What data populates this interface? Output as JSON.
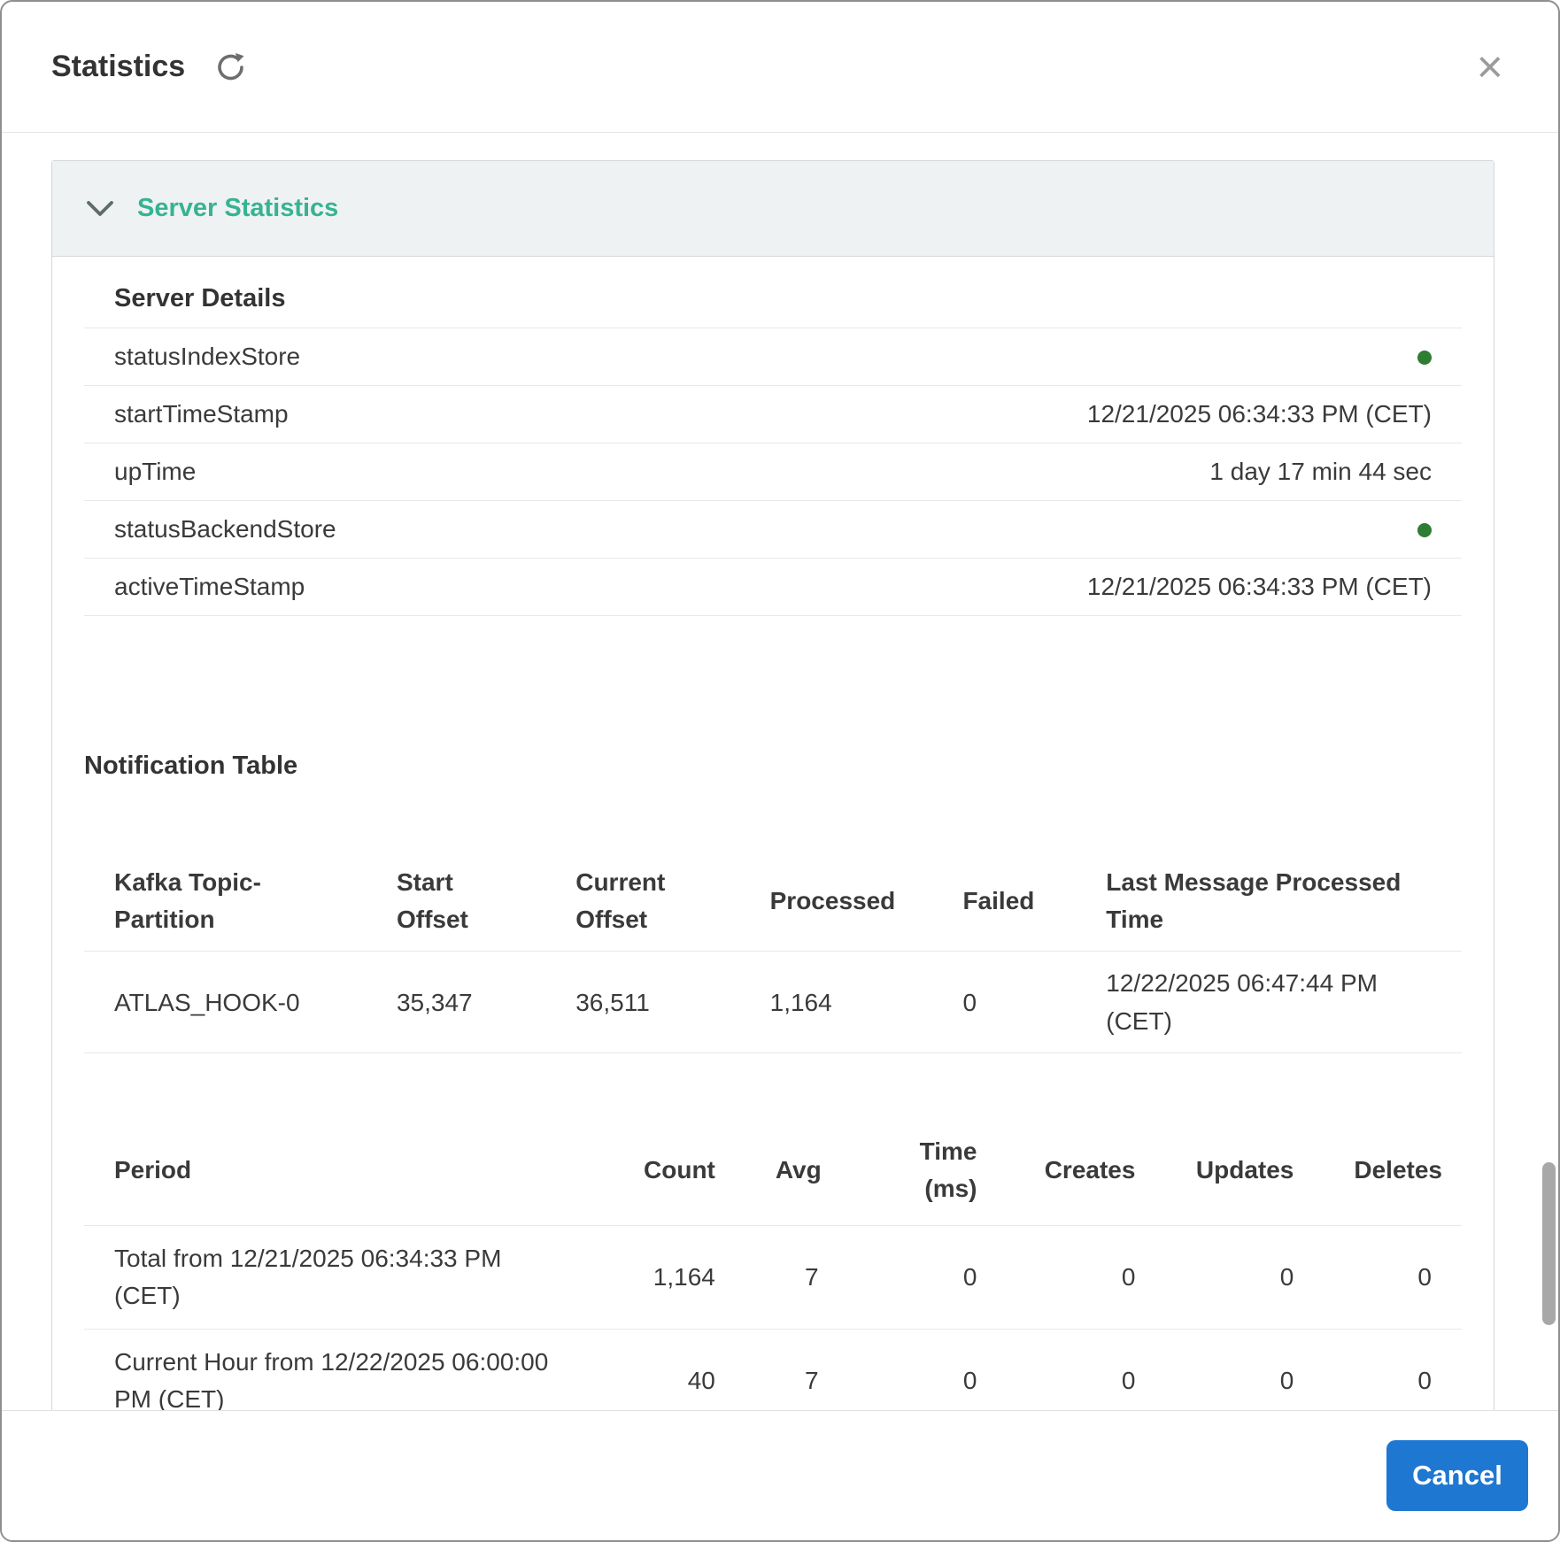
{
  "colors": {
    "accent_teal": "#36b392",
    "status_green": "#2e7d32",
    "primary_blue": "#1e78d2"
  },
  "header": {
    "title": "Statistics"
  },
  "icons": {
    "refresh_glyph": "⟳",
    "close_glyph": "×",
    "chevron_glyph": "⌄",
    "status_dot_glyph": "●"
  },
  "accordion": {
    "title": "Server Statistics"
  },
  "server_details": {
    "heading": "Server Details",
    "rows": [
      {
        "key": "statusIndexStore",
        "value": "",
        "status": "green"
      },
      {
        "key": "startTimeStamp",
        "value": "12/21/2025 06:34:33 PM (CET)"
      },
      {
        "key": "upTime",
        "value": "1 day 17 min 44 sec"
      },
      {
        "key": "statusBackendStore",
        "value": "",
        "status": "green"
      },
      {
        "key": "activeTimeStamp",
        "value": "12/21/2025 06:34:33 PM (CET)"
      }
    ]
  },
  "notification": {
    "heading": "Notification Table",
    "kafka_table": {
      "headers": [
        "Kafka Topic-Partition",
        "Start Offset",
        "Current Offset",
        "Processed",
        "Failed",
        "Last Message Processed Time"
      ],
      "rows": [
        [
          "ATLAS_HOOK-0",
          "35,347",
          "36,511",
          "1,164",
          "0",
          "12/22/2025 06:47:44 PM (CET)"
        ]
      ]
    },
    "period_table": {
      "headers": [
        "Period",
        "Count",
        "Avg",
        "Time (ms)",
        "Creates",
        "Updates",
        "Deletes"
      ],
      "rows": [
        [
          "Total from 12/21/2025 06:34:33 PM (CET)",
          "1,164",
          "7",
          "0",
          "0",
          "0",
          "0"
        ],
        [
          "Current Hour from 12/22/2025 06:00:00 PM (CET)",
          "40",
          "7",
          "0",
          "0",
          "0",
          "0"
        ]
      ]
    }
  },
  "footer": {
    "cancel_label": "Cancel"
  }
}
